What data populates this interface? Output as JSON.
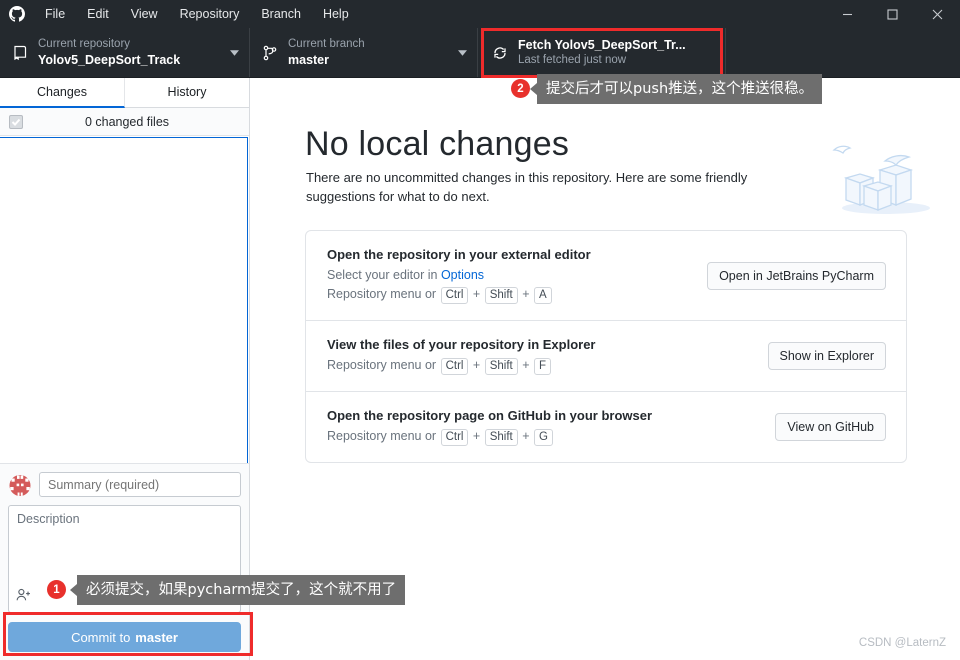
{
  "window": {
    "app_icon": "github-logo-icon",
    "menu": [
      "File",
      "Edit",
      "View",
      "Repository",
      "Branch",
      "Help"
    ],
    "controls": [
      "minimize",
      "maximize",
      "close"
    ]
  },
  "toolbar": {
    "repository": {
      "icon": "repo-book-icon",
      "label": "Current repository",
      "value": "Yolov5_DeepSort_Track"
    },
    "branch": {
      "icon": "git-branch-icon",
      "label": "Current branch",
      "value": "master"
    },
    "fetch": {
      "icon": "sync-refresh-icon",
      "label": "Fetch Yolov5_DeepSort_Tr...",
      "value": "Last fetched just now"
    }
  },
  "sidebar": {
    "tabs": [
      {
        "label": "Changes",
        "active": true
      },
      {
        "label": "History",
        "active": false
      }
    ],
    "changed_files_text": "0 changed files",
    "checkbox_state": "checked-disabled",
    "commit": {
      "avatar": "identicon-avatar",
      "summary_placeholder": "Summary (required)",
      "summary_value": "",
      "description_placeholder": "Description",
      "description_value": "",
      "coauthor_icon": "add-coauthor-icon",
      "button_prefix": "Commit to ",
      "button_branch": "master"
    }
  },
  "main": {
    "title": "No local changes",
    "subtitle": "There are no uncommitted changes in this repository. Here are some friendly suggestions for what to do next.",
    "illustration": "boxes-and-bird-illustration",
    "suggestions": [
      {
        "title": "Open the repository in your external editor",
        "desc_prefix": "Select your editor in ",
        "desc_link": "Options",
        "menu_prefix": "Repository menu or ",
        "keys": [
          "Ctrl",
          "Shift",
          "A"
        ],
        "button": "Open in JetBrains PyCharm"
      },
      {
        "title": "View the files of your repository in Explorer",
        "desc_prefix": "",
        "desc_link": "",
        "menu_prefix": "Repository menu or ",
        "keys": [
          "Ctrl",
          "Shift",
          "F"
        ],
        "button": "Show in Explorer"
      },
      {
        "title": "Open the repository page on GitHub in your browser",
        "desc_prefix": "",
        "desc_link": "",
        "menu_prefix": "Repository menu or ",
        "keys": [
          "Ctrl",
          "Shift",
          "G"
        ],
        "button": "View on GitHub"
      }
    ]
  },
  "annotations": [
    {
      "number": "1",
      "text": "必须提交，如果pycharm提交了，这个就不用了"
    },
    {
      "number": "2",
      "text": "提交后才可以push推送，这个推送很稳。"
    }
  ],
  "watermark": "CSDN @LaternZ",
  "colors": {
    "titlebar_bg": "#24292e",
    "accent_blue": "#0366d6",
    "commit_button": "#6fa8dc",
    "highlight_red": "#ef2b2b",
    "badge_red": "#e8312c",
    "tooltip_gray": "#6e6e6e"
  }
}
